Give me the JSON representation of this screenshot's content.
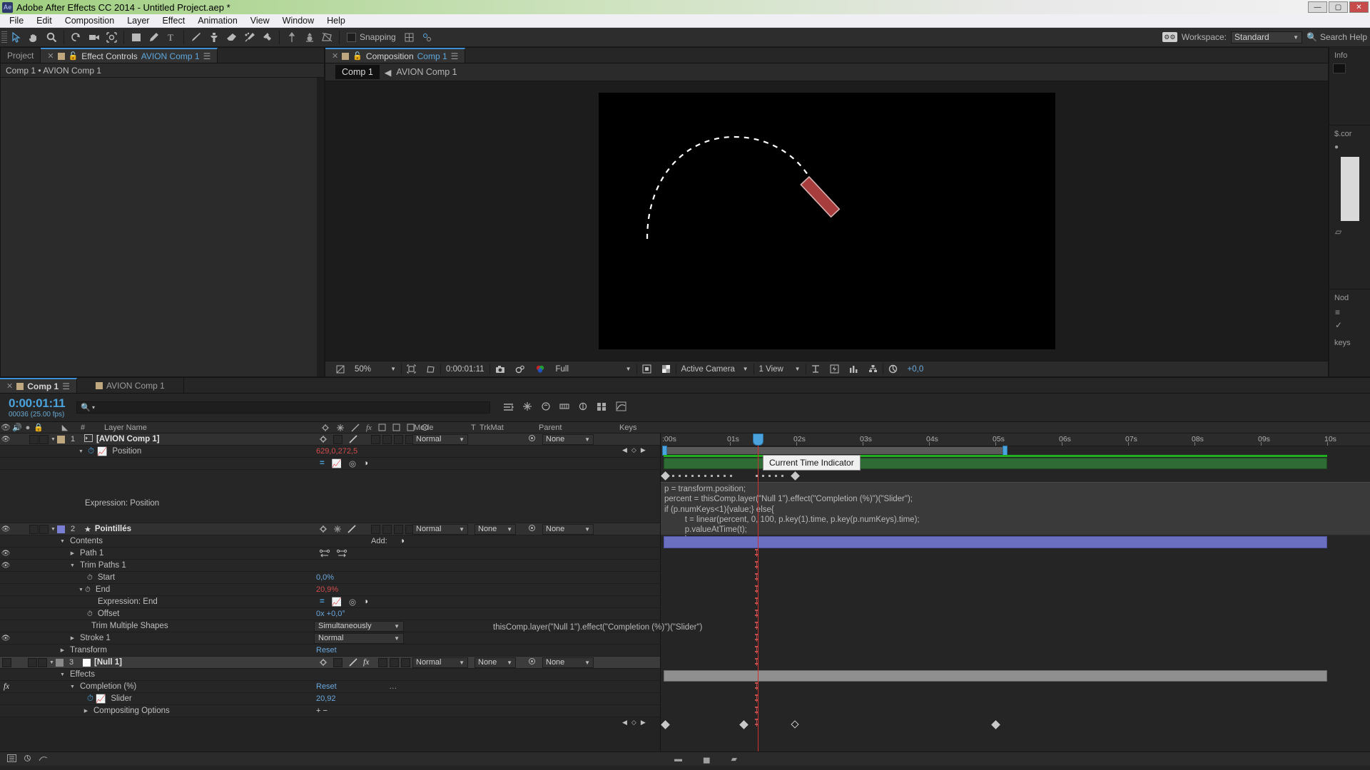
{
  "window": {
    "title": "Adobe After Effects CC 2014 - Untitled Project.aep *",
    "logo": "Ae",
    "minimize": "—",
    "maximize": "▢",
    "close": "✕"
  },
  "menubar": {
    "items": [
      "File",
      "Edit",
      "Composition",
      "Layer",
      "Effect",
      "Animation",
      "View",
      "Window",
      "Help"
    ]
  },
  "toolbar": {
    "tools": [
      "selection-tool",
      "hand-tool",
      "zoom-tool",
      "rotation-tool",
      "camera-tool",
      "pan-behind-tool",
      "shape-tool",
      "pen-tool",
      "type-tool",
      "brush-tool",
      "clone-stamp-tool",
      "eraser-tool",
      "roto-brush-tool",
      "puppet-pin-tool"
    ],
    "extra_tools": [
      "anchor-up-tool",
      "anchor-center-tool",
      "mask-tool"
    ],
    "snapping_label": "Snapping",
    "snapping_checked": false,
    "workspace_label": "Workspace:",
    "workspace_value": "Standard",
    "search_help": "Search Help"
  },
  "effect_controls": {
    "inactive_tab": "Project",
    "tab_title": "Effect Controls",
    "tab_subject": "AVION Comp 1",
    "header": "Comp 1 • AVION Comp 1"
  },
  "composition": {
    "tab_title": "Composition",
    "tab_subject": "Comp 1",
    "crumb_active": "Comp 1",
    "crumb_arrow": "◀",
    "crumb_next": "AVION Comp 1",
    "footer": {
      "zoom": "50%",
      "timecode": "0:00:01:11",
      "resolution": "Full",
      "view": "Active Camera",
      "views": "1 View",
      "exposure": "+0,0"
    }
  },
  "rail": {
    "info_label": "Info",
    "scor_label": "$.cor",
    "nod_label": "Nod",
    "keys_label": "keys"
  },
  "timeline": {
    "tabs": [
      {
        "label": "Comp 1",
        "active": true
      },
      {
        "label": "AVION Comp 1",
        "active": false
      }
    ],
    "timecode_big": "0:00:01:11",
    "timecode_small": "00036 (25.00 fps)",
    "columns": {
      "layer_name": "Layer Name",
      "mode": "Mode",
      "trkmat_t": "T",
      "trkmat": "TrkMat",
      "parent": "Parent",
      "keys": "Keys"
    },
    "tooltip": "Current Time Indicator",
    "ruler_ticks": [
      ":00s",
      "01s",
      "02s",
      "03s",
      "04s",
      "05s",
      "06s",
      "07s",
      "08s",
      "09s",
      "10s"
    ],
    "rows": [
      {
        "name": "layer-avion-comp-1",
        "kind": "layer",
        "num": "1",
        "label": "[AVION Comp 1]",
        "mode": "Normal",
        "trkmat": "None",
        "parent": "None",
        "indent": 0,
        "color": "#bfa77f"
      },
      {
        "name": "prop-position",
        "kind": "prop",
        "label": "Position",
        "value": "629,0,272,5",
        "value_color": "red",
        "indent": 2
      },
      {
        "name": "expression-position-controls",
        "kind": "exprctl",
        "indent": 3
      },
      {
        "name": "expression-position-label",
        "kind": "exprlabel",
        "label": "Expression: Position",
        "indent": 3
      },
      {
        "name": "layer-pointilles",
        "kind": "layer",
        "num": "2",
        "label": "Pointillés",
        "mode": "Normal",
        "trkmat": "None",
        "parent": "None",
        "indent": 0,
        "color": "#7b7fd4"
      },
      {
        "name": "group-contents",
        "kind": "prop",
        "label": "Contents",
        "value": "Add:",
        "indent": 2
      },
      {
        "name": "group-path-1",
        "kind": "prop",
        "label": "Path 1",
        "indent": 3
      },
      {
        "name": "group-trim-paths-1",
        "kind": "prop",
        "label": "Trim Paths 1",
        "indent": 3
      },
      {
        "name": "prop-start",
        "kind": "prop",
        "label": "Start",
        "value": "0,0%",
        "value_color": "blue",
        "indent": 4
      },
      {
        "name": "prop-end",
        "kind": "prop",
        "label": "End",
        "value": "20,9%",
        "value_color": "red",
        "indent": 4
      },
      {
        "name": "expression-end-label",
        "kind": "prop",
        "label": "Expression: End",
        "indent": 5
      },
      {
        "name": "prop-offset",
        "kind": "prop",
        "label": "Offset",
        "value": "0x +0,0°",
        "value_color": "blue",
        "indent": 4
      },
      {
        "name": "prop-trim-multiple-shapes",
        "kind": "prop",
        "label": "Trim Multiple Shapes",
        "value": "Simultaneously",
        "indent": 4
      },
      {
        "name": "group-stroke-1",
        "kind": "prop",
        "label": "Stroke 1",
        "value": "Normal",
        "indent": 3
      },
      {
        "name": "group-transform",
        "kind": "prop",
        "label": "Transform",
        "value": "Reset",
        "value_color": "blue",
        "indent": 2
      },
      {
        "name": "layer-null-1",
        "kind": "layer",
        "num": "3",
        "label": "[Null 1]",
        "mode": "Normal",
        "trkmat": "None",
        "parent": "None",
        "indent": 0,
        "color": "#8a8a8a"
      },
      {
        "name": "group-effects",
        "kind": "prop",
        "label": "Effects",
        "indent": 2
      },
      {
        "name": "effect-completion",
        "kind": "prop",
        "label": "Completion (%)",
        "value": "Reset",
        "value_color": "blue",
        "indent": 3
      },
      {
        "name": "prop-slider",
        "kind": "prop",
        "label": "Slider",
        "value": "20,92",
        "value_color": "blue",
        "indent": 4
      },
      {
        "name": "group-compositing-options",
        "kind": "prop",
        "label": "Compositing Options",
        "value": "+ −",
        "indent": 3
      }
    ],
    "expression_position": "p = transform.position;\npercent = thisComp.layer(\"Null 1\").effect(\"Completion (%)\")(\"Slider\");\nif (p.numKeys<1){value;} else{\n         t = linear(percent, 0, 100, p.key(1).time, p.key(p.numKeys).time);\n         p.valueAtTime(t);\n         };",
    "expression_end": "thisComp.layer(\"Null 1\").effect(\"Completion (%)\")(\"Slider\")",
    "add_label": "Add:"
  },
  "colors": {
    "accent_blue": "#4aa3dd",
    "value_red": "#d24b4b",
    "value_blue": "#6aa8dd",
    "green_bar": "#1faf1f",
    "cti_red": "#d03030",
    "title_green": "#9fcf7f"
  }
}
